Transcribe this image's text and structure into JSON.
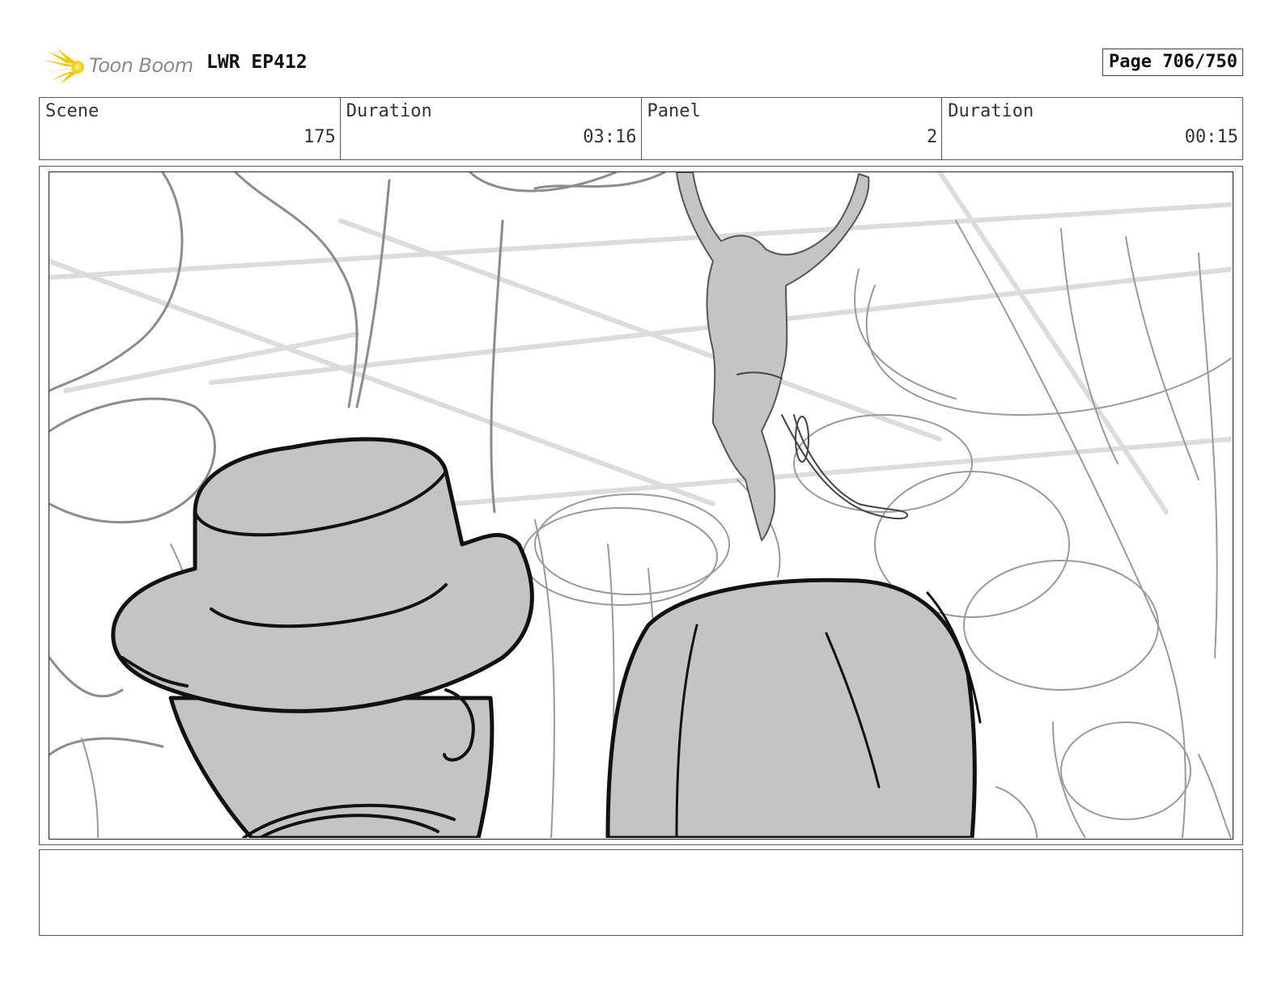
{
  "header": {
    "logo_text": "Toon Boom",
    "project_title": "LWR EP412",
    "page_number": "Page 706/750"
  },
  "info": [
    {
      "label": "Scene",
      "value": "175"
    },
    {
      "label": "Duration",
      "value": "03:16"
    },
    {
      "label": "Panel",
      "value": "2"
    },
    {
      "label": "Duration",
      "value": "00:15"
    }
  ],
  "panel": {
    "icon": "storyboard-sketch-image",
    "fill_color": "#c4c4c4"
  },
  "notes": {
    "text": ""
  }
}
